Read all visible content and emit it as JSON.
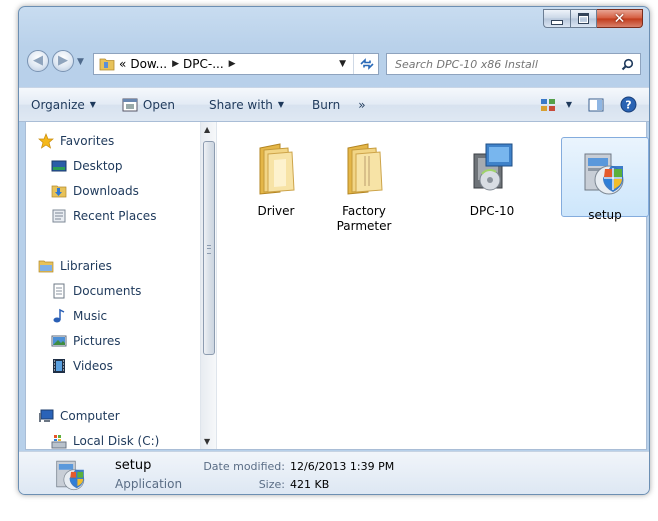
{
  "window": {
    "caption_buttons": [
      "minimize",
      "maximize",
      "close"
    ]
  },
  "nav": {
    "address_segments": [
      "«",
      "Dow...",
      "DPC-..."
    ],
    "search_placeholder": "Search DPC-10 x86 Install"
  },
  "toolbar": {
    "organize": "Organize",
    "open": "Open",
    "share_with": "Share with",
    "burn": "Burn",
    "more": "»"
  },
  "sidebar": {
    "favorites": {
      "label": "Favorites",
      "items": [
        {
          "label": "Desktop",
          "icon": "desktop-icon"
        },
        {
          "label": "Downloads",
          "icon": "downloads-icon"
        },
        {
          "label": "Recent Places",
          "icon": "recent-places-icon"
        }
      ]
    },
    "libraries": {
      "label": "Libraries",
      "items": [
        {
          "label": "Documents",
          "icon": "documents-icon"
        },
        {
          "label": "Music",
          "icon": "music-icon"
        },
        {
          "label": "Pictures",
          "icon": "pictures-icon"
        },
        {
          "label": "Videos",
          "icon": "videos-icon"
        }
      ]
    },
    "computer": {
      "label": "Computer",
      "items": [
        {
          "label": "Local Disk (C:)",
          "icon": "local-disk-icon"
        }
      ]
    }
  },
  "files": [
    {
      "name": "Driver",
      "type": "folder",
      "icon": "folder-icon"
    },
    {
      "name": "Factory Parmeter",
      "type": "folder",
      "icon": "folder-icon"
    },
    {
      "name": "DPC-10",
      "type": "installer",
      "icon": "installer-icon"
    },
    {
      "name": "setup",
      "type": "application",
      "icon": "setup-icon",
      "selected": true
    }
  ],
  "details": {
    "name": "setup",
    "type": "Application",
    "date_label": "Date modified:",
    "date_value": "12/6/2013 1:39 PM",
    "size_label": "Size:",
    "size_value": "421 KB"
  },
  "colors": {
    "frame": "#b9d1ea",
    "selection": "#cde6fb",
    "close": "#c13a1a"
  }
}
